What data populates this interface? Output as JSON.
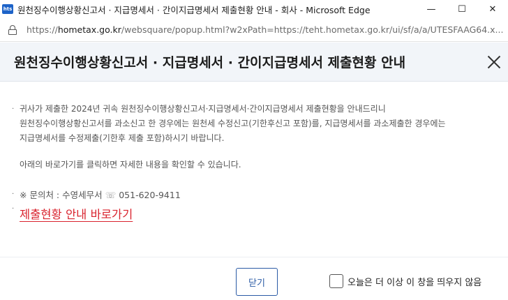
{
  "window": {
    "title": "원천징수이행상황신고서 · 지급명세서 · 간이지급명세서 제출현황 안내 - 회사 - Microsoft Edge",
    "app_icon_text": "hts",
    "controls": {
      "minimize": "—",
      "maximize": "☐",
      "close": "✕"
    }
  },
  "address": {
    "prefix": "https://",
    "domain": "hometax.go.kr",
    "rest": "/websquare/popup.html?w2xPath=https://teht.hometax.go.kr/ui/sf/a/a/UTESFAAG64.x..."
  },
  "popup": {
    "title": "원천징수이행상황신고서 · 지급명세서 · 간이지급명세서 제출현황 안내",
    "body": {
      "bullet": "·",
      "line1": "귀사가 제출한 2024년 귀속 원천징수이행상황신고서·지급명세서·간이지급명세서 제출현황을 안내드리니",
      "line2": "원천징수이행상황신고서를 과소신고 한 경우에는 원천세 수정신고(기한후신고 포함)를, 지급명세서를 과소제출한 경우에는",
      "line3": "지급명세서를 수정제출(기한후 제출 포함)하시기 바랍니다.",
      "line4": "아래의 바로가기를 클릭하면 자세한 내용을 확인할 수 있습니다.",
      "contact_prefix": "※ 문의처 : 수영세무서",
      "contact_icon": "☏",
      "contact_phone": "051-620-9411",
      "link": "제출현황 안내 바로가기"
    },
    "footer": {
      "close_button": "닫기",
      "dont_show_label": "오늘은 더 이상 이 창을 띄우지 않음",
      "dont_show_checked": false
    }
  }
}
